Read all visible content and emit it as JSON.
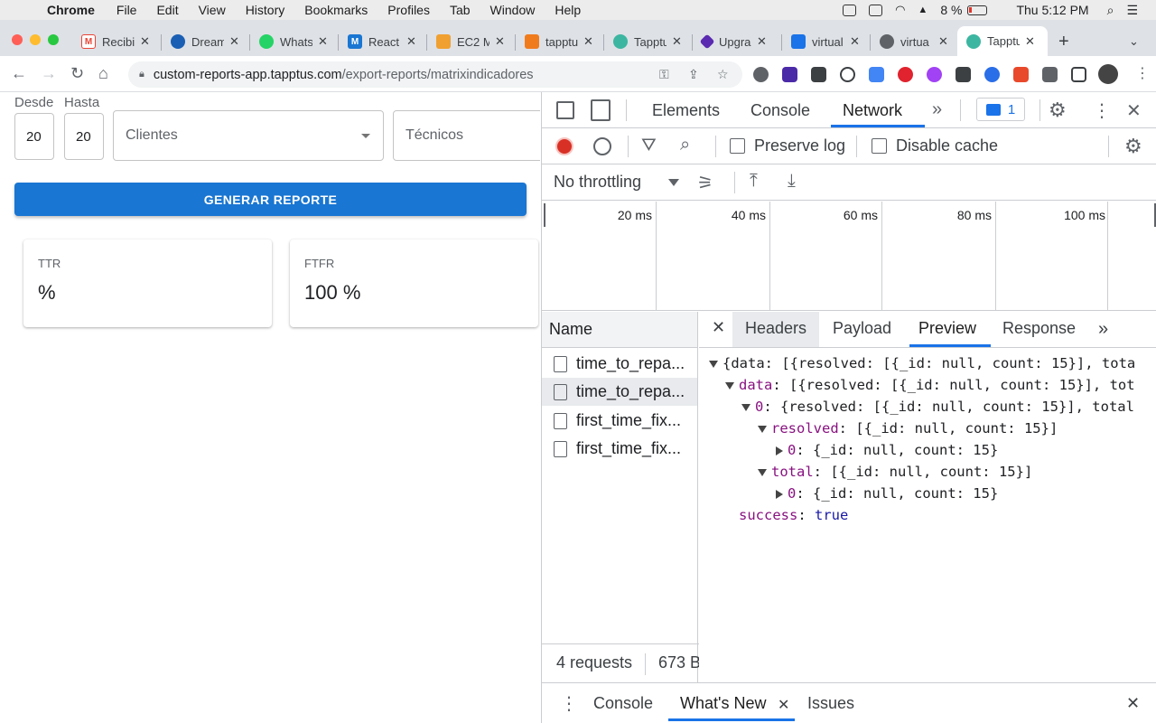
{
  "menubar": {
    "app": "Chrome",
    "items": [
      "File",
      "Edit",
      "View",
      "History",
      "Bookmarks",
      "Profiles",
      "Tab",
      "Window",
      "Help"
    ],
    "battery": "8 %",
    "clock": "Thu 5:12 PM"
  },
  "tabs": [
    {
      "label": "Recibi",
      "favicon": "gmail-icon",
      "color": "#ea4335"
    },
    {
      "label": "Dream",
      "favicon": "dreamhost-icon",
      "color": "#1a5fb4"
    },
    {
      "label": "Whats",
      "favicon": "whatsapp-icon",
      "color": "#25d366"
    },
    {
      "label": "React",
      "favicon": "mui-icon",
      "color": "#1976d2"
    },
    {
      "label": "EC2 M",
      "favicon": "aws-ec2-icon",
      "color": "#f0a030"
    },
    {
      "label": "tapptu",
      "favicon": "box-icon",
      "color": "#f07b1d"
    },
    {
      "label": "Tapptu",
      "favicon": "tapptus-icon",
      "color": "#3cb6a0"
    },
    {
      "label": "Upgra",
      "favicon": "upgrade-icon",
      "color": "#5a2ab0"
    },
    {
      "label": "virtual",
      "favicon": "shield-icon",
      "color": "#1a73e8"
    },
    {
      "label": "virtua",
      "favicon": "globe-icon",
      "color": "#5f6368"
    },
    {
      "label": "Tapptu",
      "favicon": "tapptus-icon",
      "color": "#3cb6a0",
      "active": true
    }
  ],
  "omnibox": {
    "host": "custom-reports-app.tapptus.com",
    "path": "/export-reports/matrixindicadores"
  },
  "page": {
    "desde_label": "Desde",
    "hasta_label": "Hasta",
    "desde_value": "20",
    "hasta_value": "20",
    "clientes_placeholder": "Clientes",
    "tecnicos_placeholder": "Técnicos",
    "generate_button": "GENERAR REPORTE",
    "cards": [
      {
        "label": "TTR",
        "value": "%"
      },
      {
        "label": "FTFR",
        "value": "100 %"
      }
    ]
  },
  "devtools": {
    "tabs": [
      "Elements",
      "Console",
      "Network"
    ],
    "active_tab": "Network",
    "issues_badge": "1",
    "preserve_log": "Preserve log",
    "disable_cache": "Disable cache",
    "throttling": "No throttling",
    "timeline_labels": [
      "20 ms",
      "40 ms",
      "60 ms",
      "80 ms",
      "100 ms"
    ],
    "name_header": "Name",
    "requests": [
      {
        "name": "time_to_repa..."
      },
      {
        "name": "time_to_repa...",
        "selected": true
      },
      {
        "name": "first_time_fix..."
      },
      {
        "name": "first_time_fix..."
      }
    ],
    "footer_requests": "4 requests",
    "footer_size": "673 B",
    "detail_tabs": [
      "Headers",
      "Payload",
      "Preview",
      "Response"
    ],
    "active_detail_tab": "Preview",
    "preview_lines": [
      "{data: [{resolved: [{_id: null, count: 15}], tota",
      "data: [{resolved: [{_id: null, count: 15}], tot",
      "0: {resolved: [{_id: null, count: 15}], total",
      "resolved: [{_id: null, count: 15}]",
      "0: {_id: null, count: 15}",
      "total: [{_id: null, count: 15}]",
      "0: {_id: null, count: 15}",
      "success: true"
    ],
    "drawer_tabs": [
      "Console",
      "What's New",
      "Issues"
    ]
  }
}
